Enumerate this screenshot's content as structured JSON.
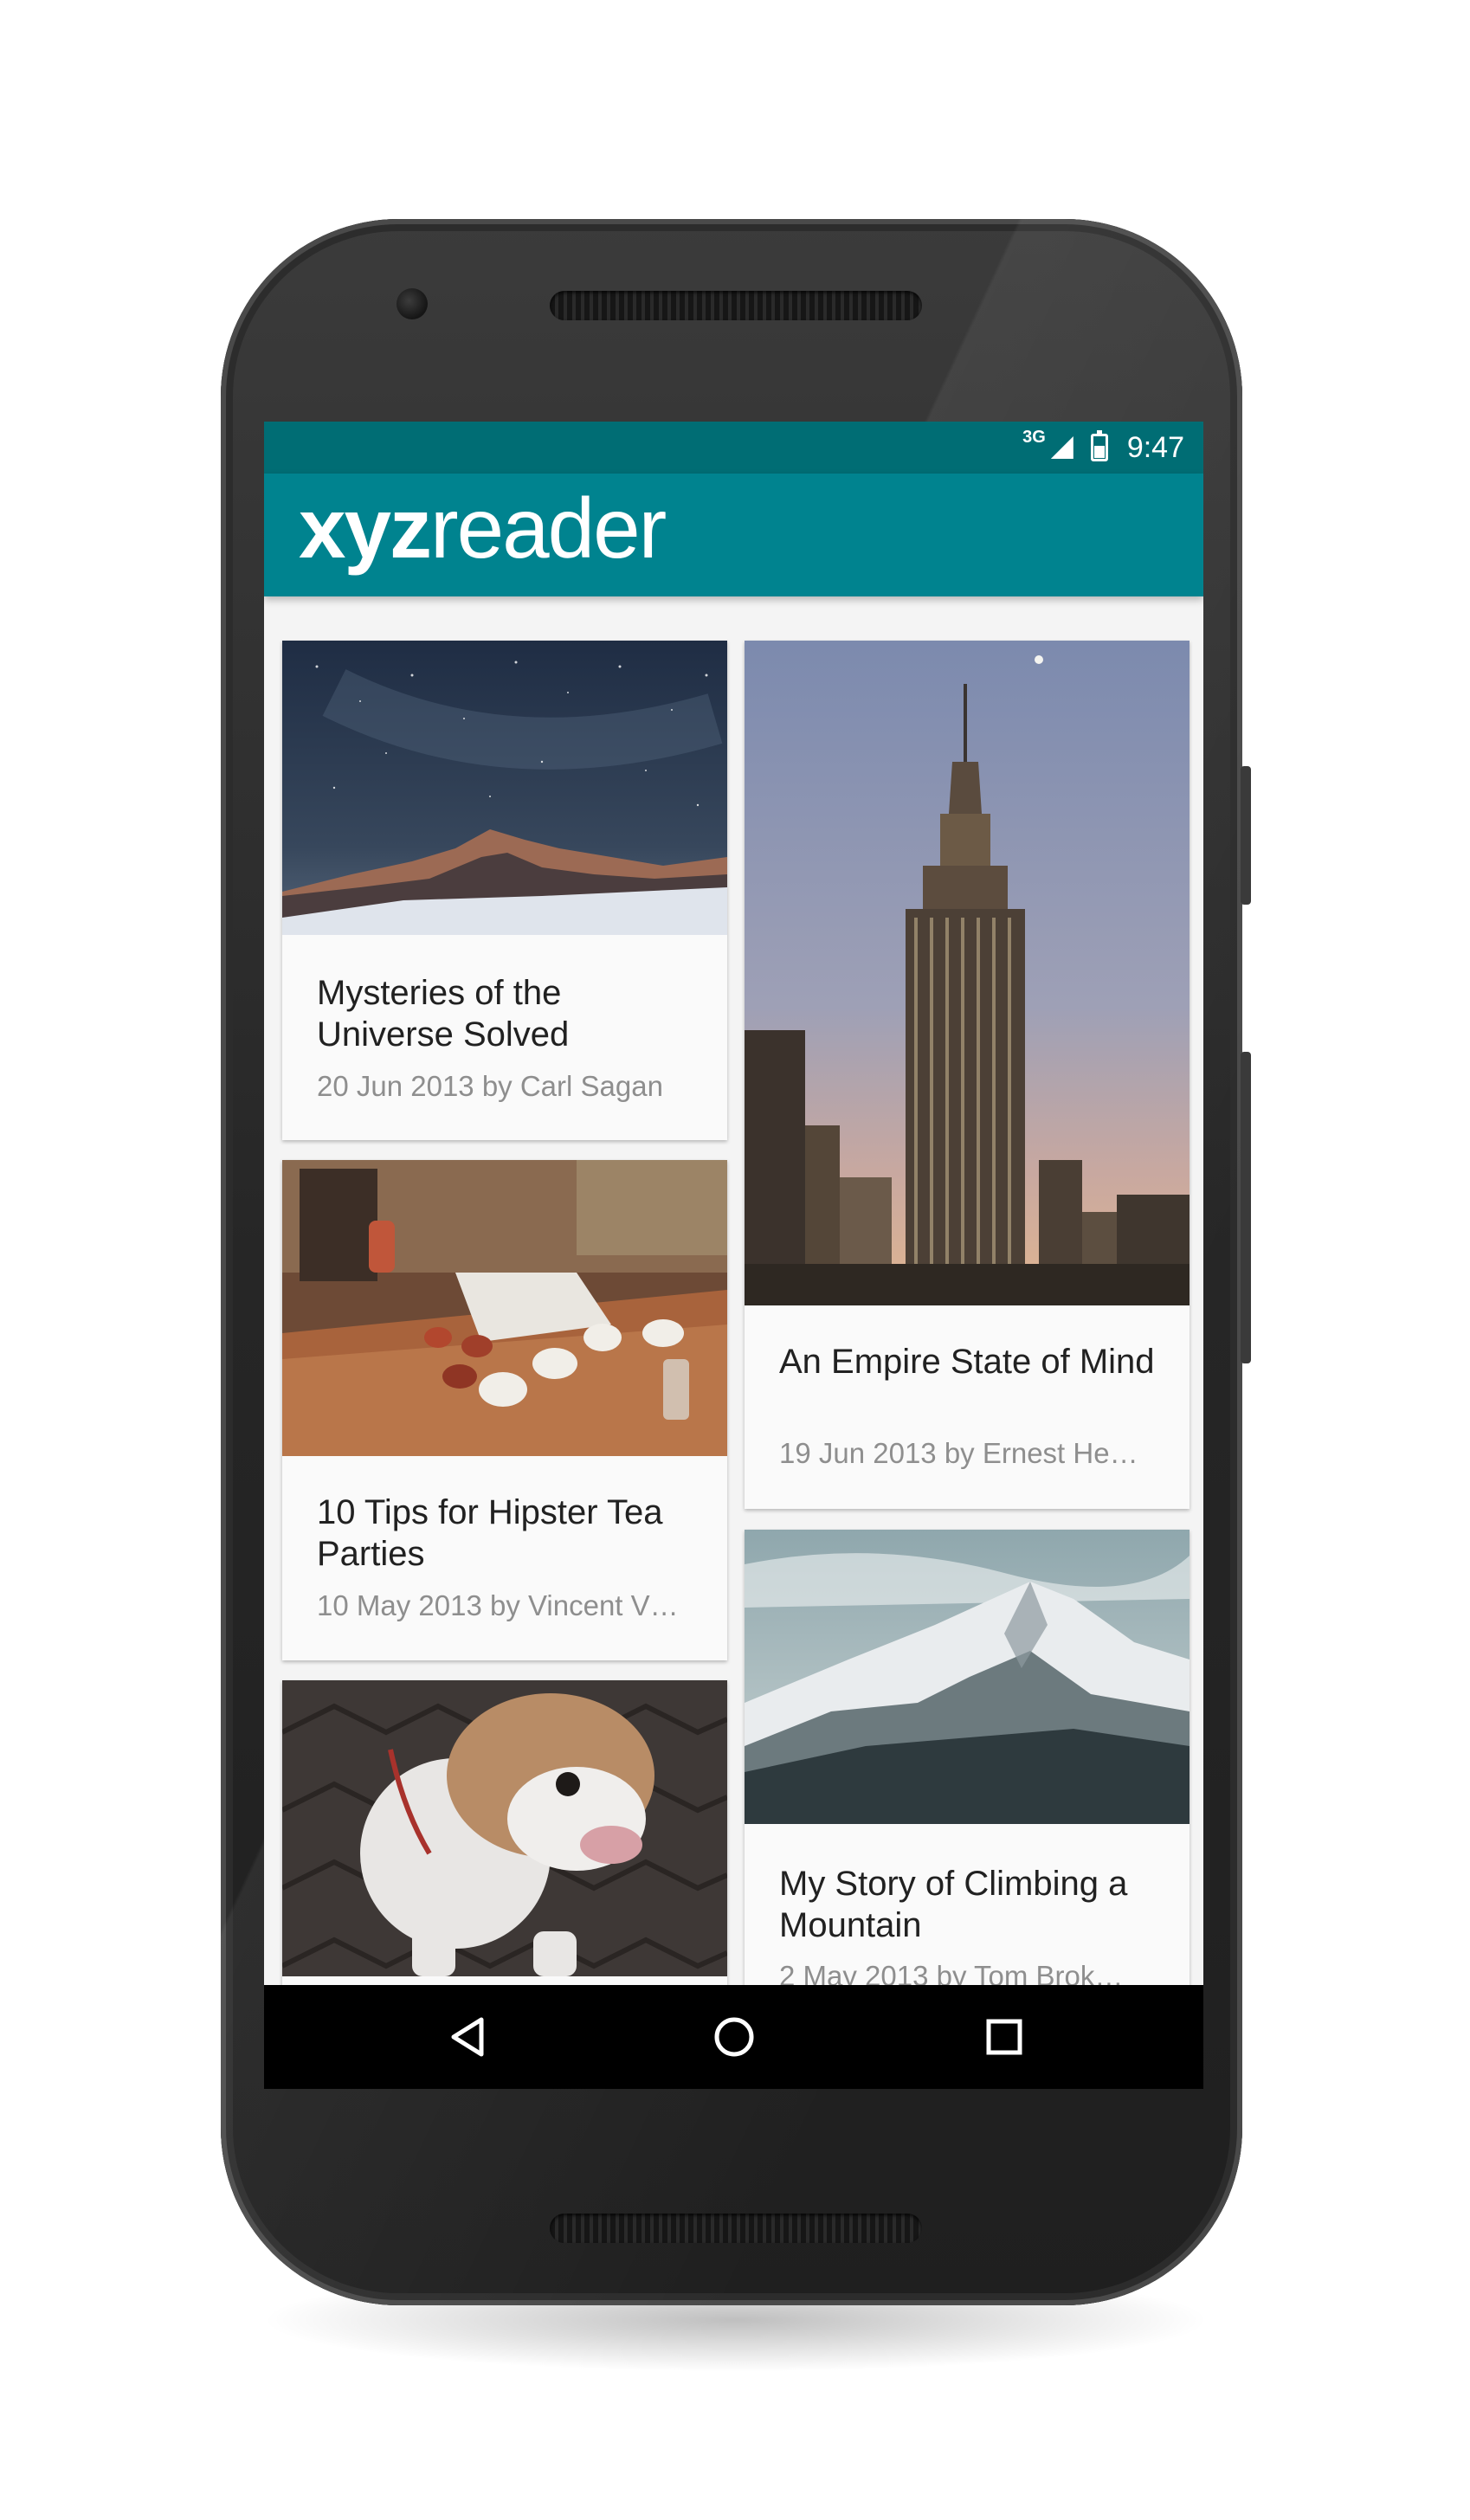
{
  "status_bar": {
    "network": "3G",
    "time": "9:47"
  },
  "app_bar": {
    "logo_bold": "xyz",
    "logo_light": "reader"
  },
  "articles": [
    {
      "title": "Mysteries of the Universe Solved",
      "subtitle": "20 Jun 2013 by Carl Sagan",
      "image": "starry-mountain-night"
    },
    {
      "title": "An Empire State of Mind",
      "subtitle": "19 Jun 2013 by Ernest He…",
      "image": "empire-state-building"
    },
    {
      "title": "10 Tips for Hipster Tea Parties",
      "subtitle": "10 May 2013 by Vincent V…",
      "image": "tea-cups-on-table"
    },
    {
      "title": "My Story of Climbing a Mountain",
      "subtitle": "2 May 2013 by Tom Brok…",
      "image": "snowy-mountain"
    },
    {
      "title": "",
      "subtitle": "",
      "image": "bulldog"
    }
  ],
  "nav_bar": {
    "back": "back-icon",
    "home": "home-icon",
    "recents": "recents-icon"
  }
}
